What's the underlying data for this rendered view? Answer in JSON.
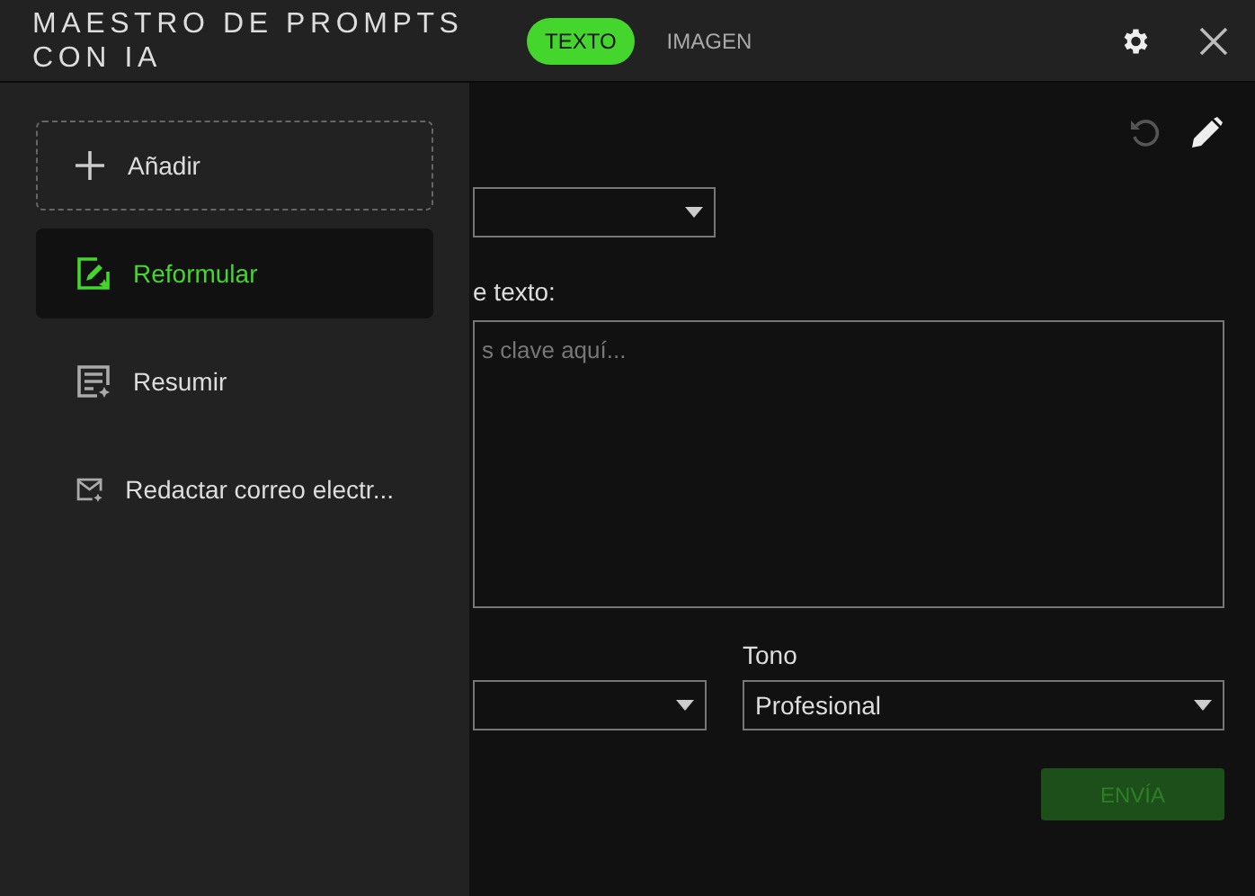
{
  "window": {
    "title_lines": [
      "MAESTRO DE PROMPTS",
      "CON IA"
    ]
  },
  "tabs": [
    {
      "label": "TEXTO",
      "selected": true
    },
    {
      "label": "IMAGEN",
      "selected": false
    }
  ],
  "sidebar": {
    "add_label": "Añadir",
    "items": [
      {
        "label": "Reformular",
        "kind": "edit",
        "selected": true
      },
      {
        "label": "Resumir",
        "kind": "list",
        "selected": false
      },
      {
        "label": "Redactar correo electr...",
        "kind": "mail",
        "selected": false
      }
    ]
  },
  "form": {
    "text_label": "e texto:",
    "text_placeholder": "s clave aquí...",
    "tone_label": "Tono",
    "tone_value": "Profesional",
    "submit": {
      "label": "ENVÍA",
      "disabled": true
    }
  }
}
